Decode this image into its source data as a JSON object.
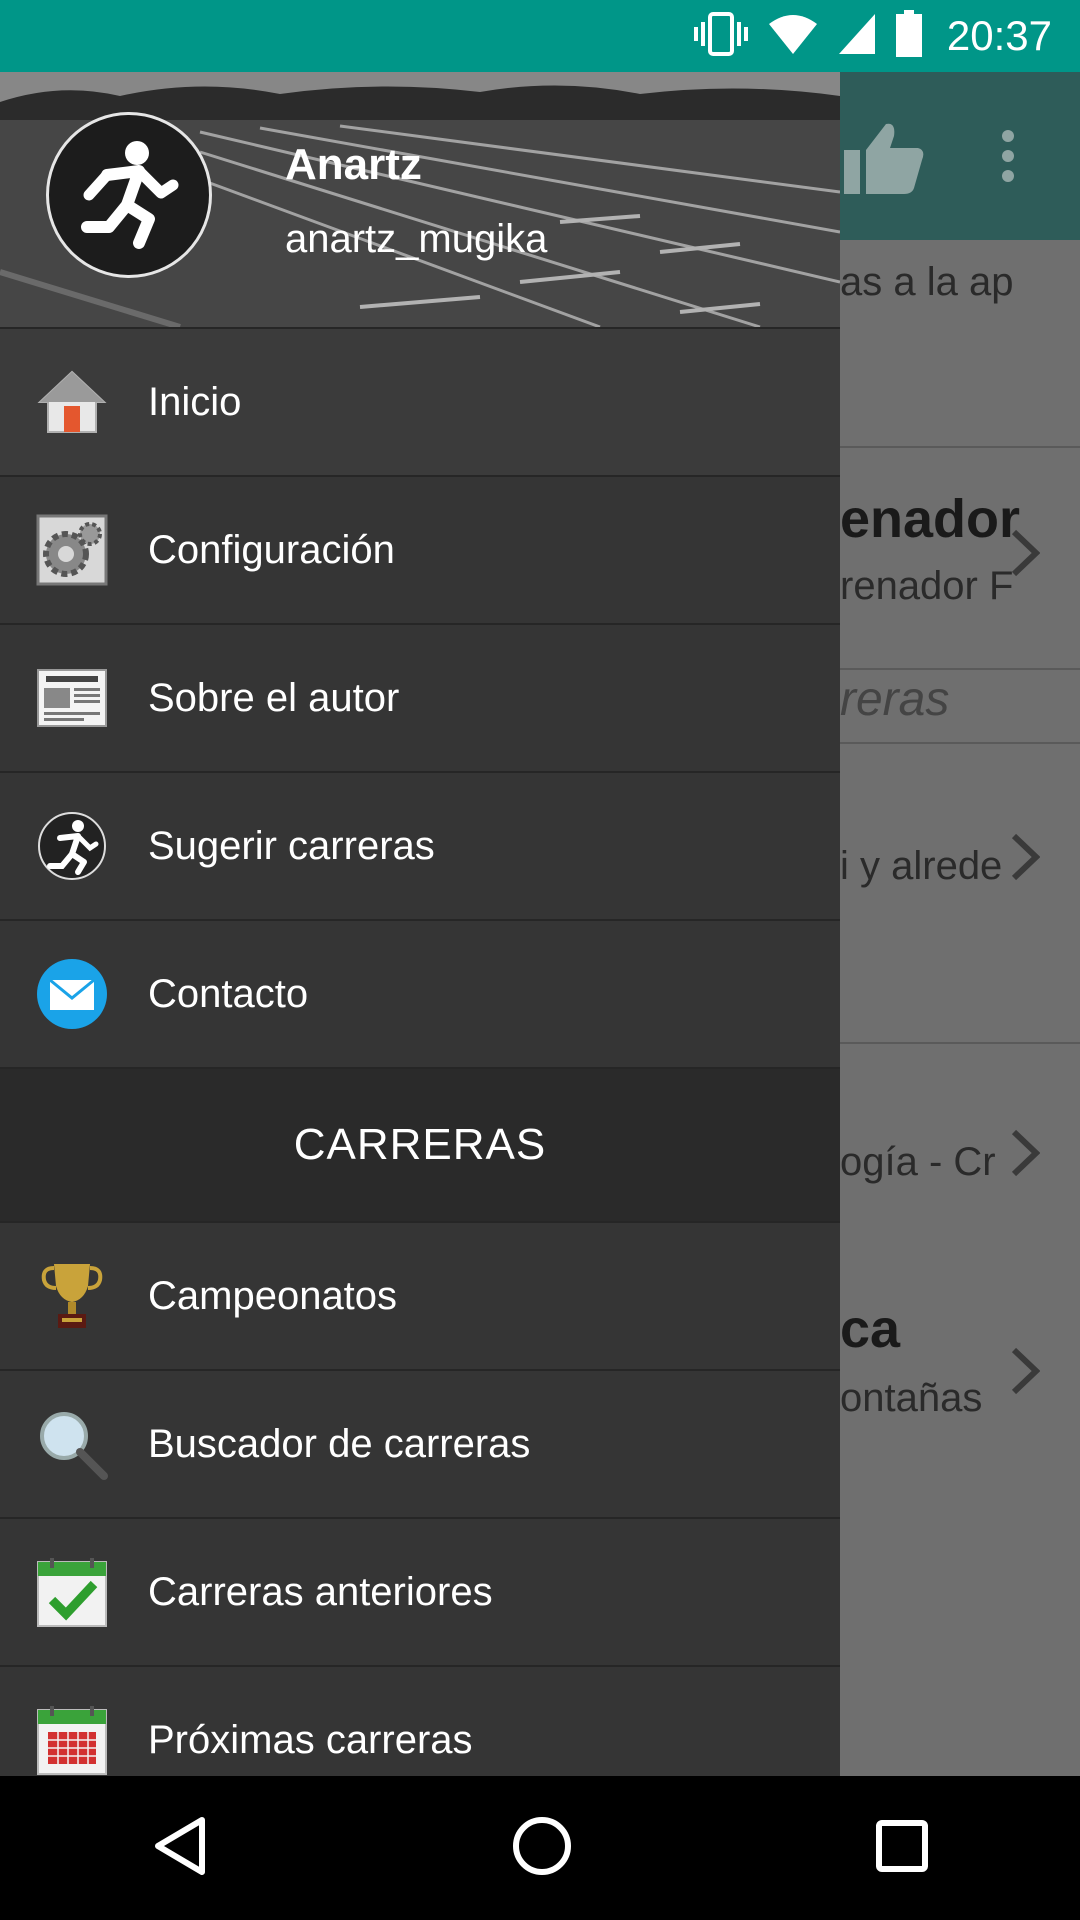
{
  "status_bar": {
    "time": "20:37"
  },
  "background_app": {
    "items": [
      {
        "title": "",
        "subtitle": "as a la ap"
      },
      {
        "title": "enador",
        "subtitle": "renador F"
      },
      {
        "title": "",
        "subtitle": "reras",
        "italic": true
      },
      {
        "title": "",
        "subtitle": "i y alrede"
      },
      {
        "title": "",
        "subtitle": "ogía - Cr"
      },
      {
        "title": "ca",
        "subtitle": "ontañas"
      }
    ]
  },
  "drawer": {
    "header": {
      "name": "Anartz",
      "handle": "anartz_mugika"
    },
    "menu": [
      {
        "label": "Inicio",
        "icon": "home-icon"
      },
      {
        "label": "Configuración",
        "icon": "gear-icon"
      },
      {
        "label": "Sobre el autor",
        "icon": "newspaper-icon"
      },
      {
        "label": "Sugerir carreras",
        "icon": "runner-icon"
      },
      {
        "label": "Contacto",
        "icon": "mail-icon"
      }
    ],
    "section_title": "CARRERAS",
    "section_menu": [
      {
        "label": "Campeonatos",
        "icon": "trophy-icon"
      },
      {
        "label": "Buscador de carreras",
        "icon": "magnifier-icon"
      },
      {
        "label": "Carreras anteriores",
        "icon": "calendar-check-icon"
      },
      {
        "label": "Próximas carreras",
        "icon": "calendar-grid-icon"
      }
    ]
  },
  "colors": {
    "status_bar": "#009688",
    "drawer": "#333333",
    "section": "#2a2a2a",
    "toolbar_dimmed": "#2e5c59"
  }
}
